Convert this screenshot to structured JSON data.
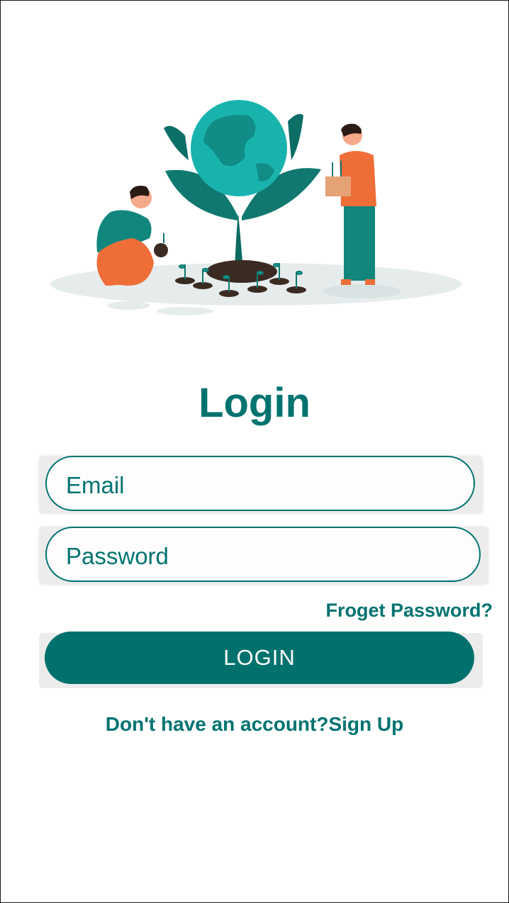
{
  "header": {
    "title": "Login",
    "illustration_icon": "people-planting-globe-tree"
  },
  "form": {
    "email": {
      "placeholder": "Email",
      "value": ""
    },
    "password": {
      "placeholder": "Password",
      "value": ""
    },
    "forgot_label": "Froget Password?",
    "login_label": "LOGIN"
  },
  "footer": {
    "prompt": "Don't have an account?",
    "signup_label": "Sign Up"
  },
  "colors": {
    "accent": "#007370",
    "button_bg": "#00716c",
    "button_text": "#ffffff",
    "field_shadow": "#ececec"
  }
}
